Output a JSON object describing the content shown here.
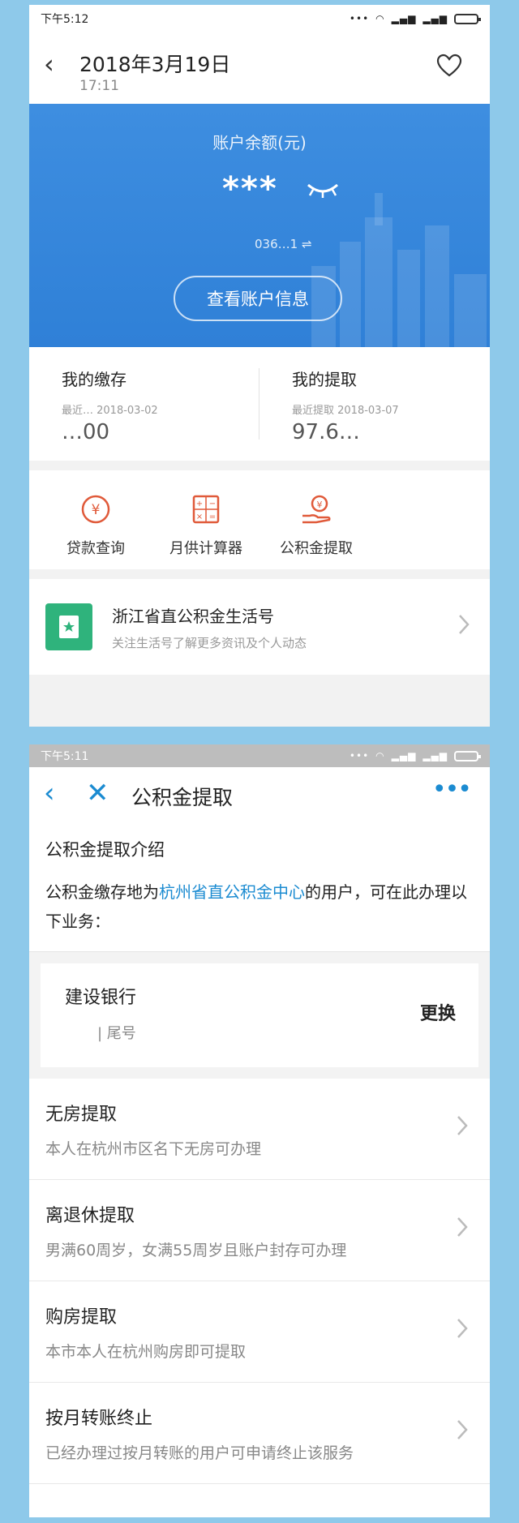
{
  "screen1": {
    "status": {
      "time": "下午5:12",
      "signal": "..."
    },
    "header": {
      "date": "2018年3月19日",
      "time": "17:11"
    },
    "balance": {
      "label": "账户余额(元)",
      "masked": "***",
      "account_partial": "036…1 ⇌",
      "button": "查看账户信息"
    },
    "summary": {
      "deposit": {
        "title": "我的缴存",
        "sub": "最近… 2018-03-02",
        "amount": "…00"
      },
      "withdraw": {
        "title": "我的提取",
        "sub": "最近提取 2018-03-07",
        "amount": "97.6…"
      }
    },
    "quick_actions": [
      {
        "label": "贷款查询",
        "icon": "yen-circle-icon"
      },
      {
        "label": "月供计算器",
        "icon": "calculator-icon"
      },
      {
        "label": "公积金提取",
        "icon": "hand-coin-icon"
      }
    ],
    "service": {
      "name": "浙江省直公积金生活号",
      "desc": "关注生活号了解更多资讯及个人动态"
    }
  },
  "screen2": {
    "status": {
      "time": "下午5:11"
    },
    "header": {
      "title": "公积金提取"
    },
    "intro": {
      "heading": "公积金提取介绍",
      "text_before": "公积金缴存地为",
      "link": "杭州省直公积金中心",
      "text_after": "的用户，可在此办理以下业务："
    },
    "bank": {
      "name": "建设银行",
      "tail": "| 尾号",
      "change": "更换"
    },
    "options": [
      {
        "title": "无房提取",
        "desc": "本人在杭州市区名下无房可办理"
      },
      {
        "title": "离退休提取",
        "desc": "男满60周岁，女满55周岁且账户封存可办理"
      },
      {
        "title": "购房提取",
        "desc": "本市本人在杭州购房即可提取"
      },
      {
        "title": "按月转账终止",
        "desc": "已经办理过按月转账的用户可申请终止该服务"
      }
    ]
  }
}
